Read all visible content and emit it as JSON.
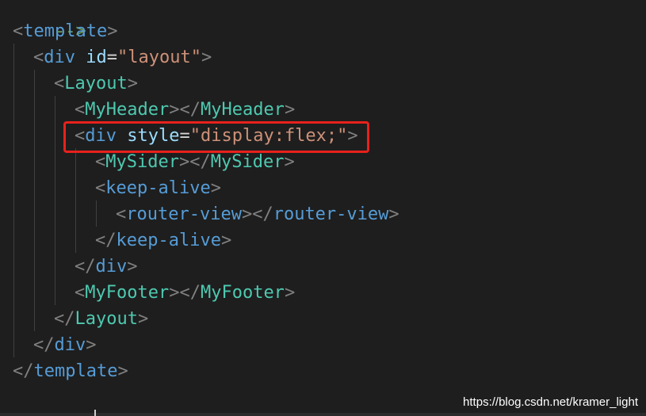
{
  "colors": {
    "background": "#1e1e1e",
    "punctuation": "#808080",
    "tag": "#569cd6",
    "component": "#4ec9b0",
    "attribute": "#9cdcfe",
    "string": "#ce9178",
    "comment": "#6a9955",
    "highlight": "#e8211c"
  },
  "code": {
    "comment_end": "-->",
    "template": "template",
    "div": "div",
    "id_attr": "id",
    "id_value": "\"layout\"",
    "layout": "Layout",
    "my_header": "MyHeader",
    "style_attr": "style",
    "style_value": "\"display:flex;\"",
    "my_sider": "MySider",
    "keep_alive": "keep-alive",
    "router_view": "router-view",
    "my_footer": "MyFooter",
    "equals": "="
  },
  "watermark": "https://blog.csdn.net/kramer_light"
}
